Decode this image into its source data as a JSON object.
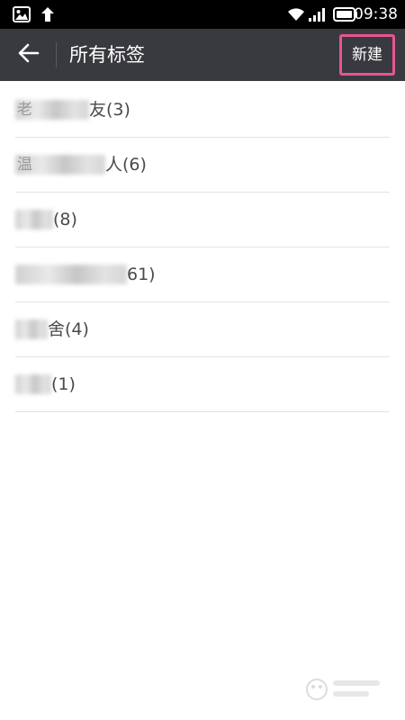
{
  "status_bar": {
    "time": "09:38",
    "left_icons": [
      "image-icon",
      "upload-arrow-icon"
    ],
    "right_icons": [
      "wifi-icon",
      "signal-icon",
      "battery-icon"
    ]
  },
  "header": {
    "back_icon": "arrow-left-icon",
    "title": "所有标签",
    "new_button_label": "新建",
    "highlight_color": "#e8558f",
    "background_color": "#393a3f"
  },
  "tags": [
    {
      "prefix": "老",
      "visible_text": "友(3)"
    },
    {
      "prefix": "温",
      "visible_text": "人(6)"
    },
    {
      "prefix": "",
      "visible_text": "(8)"
    },
    {
      "prefix": "",
      "visible_text": "61)"
    },
    {
      "prefix": "",
      "visible_text": "舍(4)"
    },
    {
      "prefix": "",
      "visible_text": "(1)"
    }
  ]
}
